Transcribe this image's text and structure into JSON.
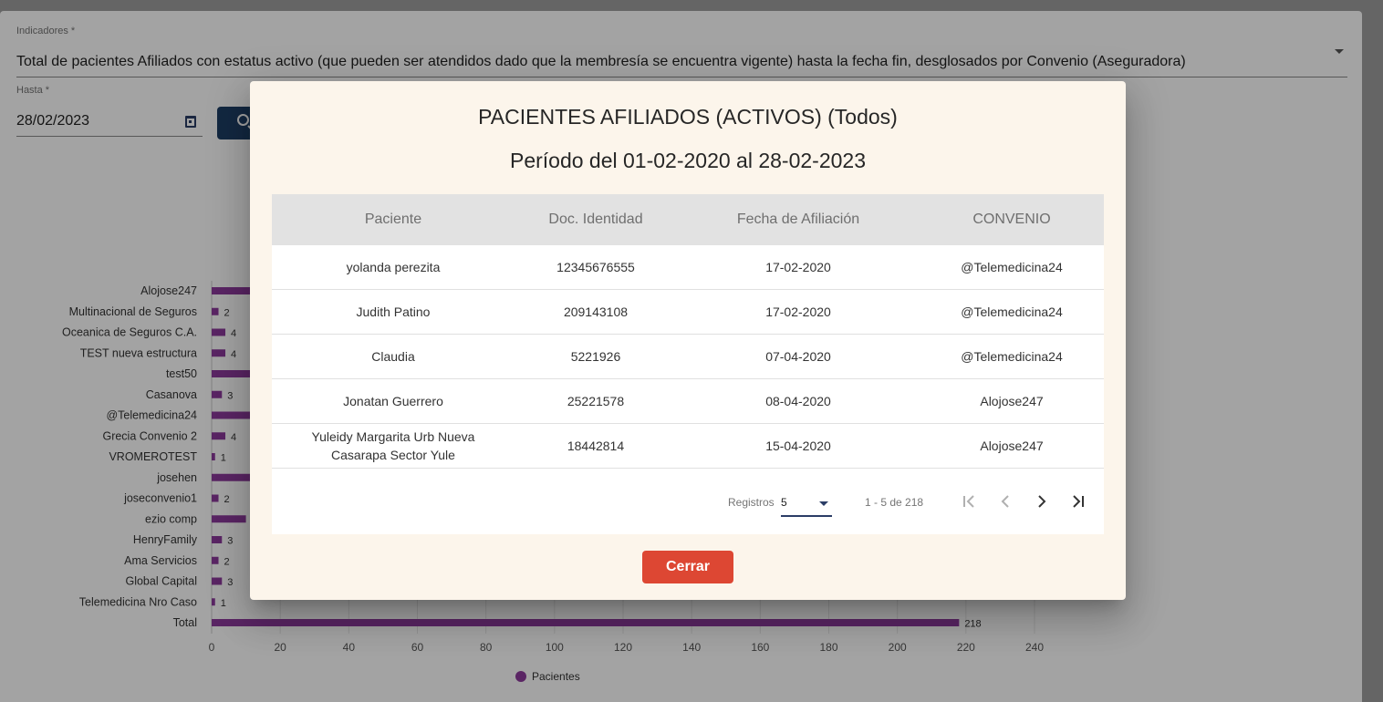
{
  "form": {
    "indicator_label": "Indicadores *",
    "indicator_value": "Total de pacientes Afiliados con estatus activo (que pueden ser atendidos dado que la membresía se encuentra vigente) hasta la fecha fin, desglosados por Convenio (Aseguradora)",
    "date_label": "Hasta *",
    "date_value": "28/02/2023"
  },
  "chart_data": {
    "type": "bar",
    "orientation": "horizontal",
    "categories": [
      "Alojose247",
      "Multinacional de Seguros",
      "Oceanica de Seguros C.A.",
      "TEST nueva estructura",
      "test50",
      "Casanova",
      "@Telemedicina24",
      "Grecia Convenio 2",
      "VROMEROTEST",
      "josehen",
      "joseconvenio1",
      "ezio comp",
      "HenryFamily",
      "Ama Servicios",
      "Global Capital",
      "Telemedicina Nro Caso",
      "Total"
    ],
    "series": [
      {
        "name": "Pacientes",
        "values": [
          12,
          2,
          4,
          4,
          12,
          3,
          12,
          4,
          1,
          12,
          2,
          10,
          3,
          2,
          3,
          1,
          218
        ]
      }
    ],
    "value_labels": [
      "",
      "2",
      "4",
      "4",
      "",
      "3",
      "",
      "4",
      "1",
      "",
      "2",
      "",
      "3",
      "2",
      "3",
      "1",
      "218"
    ],
    "xticks": [
      "0",
      "20",
      "40",
      "60",
      "80",
      "100",
      "120",
      "140",
      "160",
      "180",
      "200",
      "220",
      "240"
    ],
    "xlim": [
      0,
      240
    ],
    "legend": "bottom",
    "grid": true,
    "colors": {
      "bar": "#8e3a9d"
    }
  },
  "dialog": {
    "title": "PACIENTES AFILIADOS (ACTIVOS) (Todos)",
    "subtitle": "Período del 01-02-2020 al 28-02-2023",
    "columns": [
      "Paciente",
      "Doc. Identidad",
      "Fecha de Afiliación",
      "CONVENIO"
    ],
    "rows": [
      {
        "paciente": "yolanda perezita",
        "doc": "12345676555",
        "fecha": "17-02-2020",
        "convenio": "@Telemedicina24"
      },
      {
        "paciente": "Judith Patino",
        "doc": "209143108",
        "fecha": "17-02-2020",
        "convenio": "@Telemedicina24"
      },
      {
        "paciente": "Claudia",
        "doc": "5221926",
        "fecha": "07-04-2020",
        "convenio": "@Telemedicina24"
      },
      {
        "paciente": "Jonatan Guerrero",
        "doc": "25221578",
        "fecha": "08-04-2020",
        "convenio": "Alojose247"
      },
      {
        "paciente": "Yuleidy Margarita Urb Nueva Casarapa Sector Yule",
        "doc": "18442814",
        "fecha": "15-04-2020",
        "convenio": "Alojose247"
      }
    ],
    "paginator": {
      "label": "Registros",
      "page_size": "5",
      "range": "1 - 5 de 218"
    },
    "close_label": "Cerrar"
  },
  "icons": {
    "indicator_dropdown": "chevron-down-icon",
    "date_picker": "calendar-icon",
    "search": "search-icon",
    "first_page": "first-page-icon",
    "prev_page": "chevron-left-icon",
    "next_page": "chevron-right-icon",
    "last_page": "last-page-icon"
  }
}
